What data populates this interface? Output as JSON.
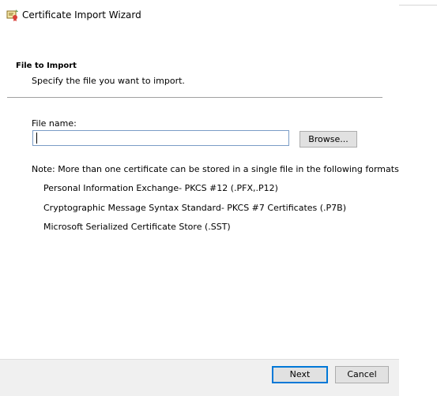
{
  "window": {
    "title": "Certificate Import Wizard",
    "title_icon": "certificate-wizard-icon"
  },
  "page": {
    "heading": "File to Import",
    "subheading": "Specify the file you want to import."
  },
  "file": {
    "label": "File name:",
    "value": "",
    "browse_label": "Browse..."
  },
  "note": "Note:  More than one certificate can be stored in a single file in the following formats:",
  "formats": [
    "Personal Information Exchange- PKCS #12 (.PFX,.P12)",
    "Cryptographic Message Syntax Standard- PKCS #7 Certificates (.P7B)",
    "Microsoft Serialized Certificate Store (.SST)"
  ],
  "footer": {
    "next_label": "Next",
    "cancel_label": "Cancel"
  },
  "colors": {
    "accent": "#0078d7",
    "footer_bg": "#f0f0f0",
    "button_bg": "#e1e1e1"
  }
}
